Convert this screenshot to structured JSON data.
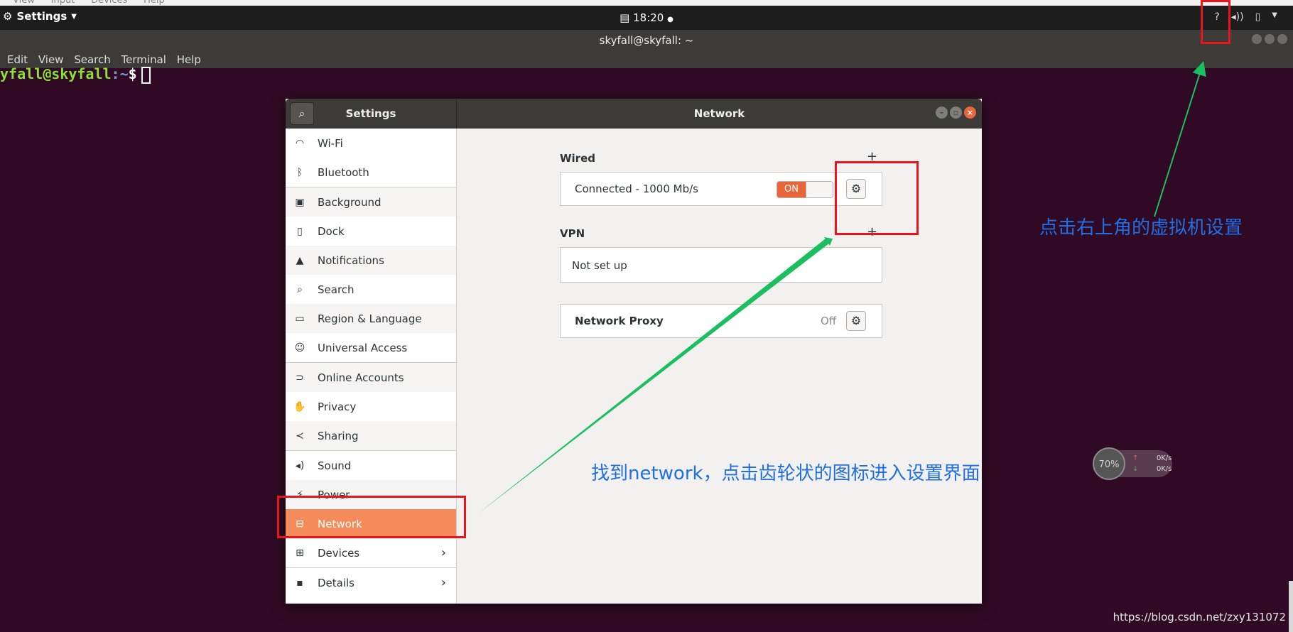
{
  "vm_menu": [
    "View",
    "Input",
    "Devices",
    "Help"
  ],
  "top_bar": {
    "app_name": "Settings",
    "clock_icon": "calendar-icon",
    "clock": "18:20",
    "tray_help": "?"
  },
  "terminal": {
    "title": "skyfall@skyfall: ~",
    "menu": [
      "Edit",
      "View",
      "Search",
      "Terminal",
      "Help"
    ],
    "prompt_user": "yfall@skyfall",
    "prompt_path": ":~",
    "prompt_symbol": "$"
  },
  "settings": {
    "sidebar_title": "Settings",
    "panel_title": "Network",
    "sidebar_items": [
      {
        "label": "Wi-Fi",
        "icon": "wifi-icon"
      },
      {
        "label": "Bluetooth",
        "icon": "bluetooth-icon"
      },
      {
        "label": "Background",
        "icon": "background-icon"
      },
      {
        "label": "Dock",
        "icon": "dock-icon"
      },
      {
        "label": "Notifications",
        "icon": "bell-icon"
      },
      {
        "label": "Search",
        "icon": "search-icon"
      },
      {
        "label": "Region & Language",
        "icon": "region-icon"
      },
      {
        "label": "Universal Access",
        "icon": "accessibility-icon"
      },
      {
        "label": "Online Accounts",
        "icon": "online-accounts-icon"
      },
      {
        "label": "Privacy",
        "icon": "hand-icon"
      },
      {
        "label": "Sharing",
        "icon": "share-icon"
      },
      {
        "label": "Sound",
        "icon": "speaker-icon"
      },
      {
        "label": "Power",
        "icon": "power-icon"
      },
      {
        "label": "Network",
        "icon": "network-icon",
        "active": true
      },
      {
        "label": "Devices",
        "icon": "devices-icon"
      },
      {
        "label": "Details",
        "icon": "info-icon"
      }
    ],
    "wired": {
      "title": "Wired",
      "status": "Connected - 1000 Mb/s",
      "toggle_on": "ON"
    },
    "vpn": {
      "title": "VPN",
      "status": "Not set up"
    },
    "proxy": {
      "label": "Network Proxy",
      "status": "Off"
    }
  },
  "annotations": {
    "top_right_note": "点击右上角的虚拟机设置",
    "network_note": "找到network，点击齿轮状的图标进入设置界面",
    "arrow_color": "#1bbf5f",
    "box_color": "#e8141e"
  },
  "net_widget": {
    "percent": "70%",
    "upload": "0K/s",
    "download": "0K/s"
  },
  "watermark": "https://blog.csdn.net/zxy131072"
}
